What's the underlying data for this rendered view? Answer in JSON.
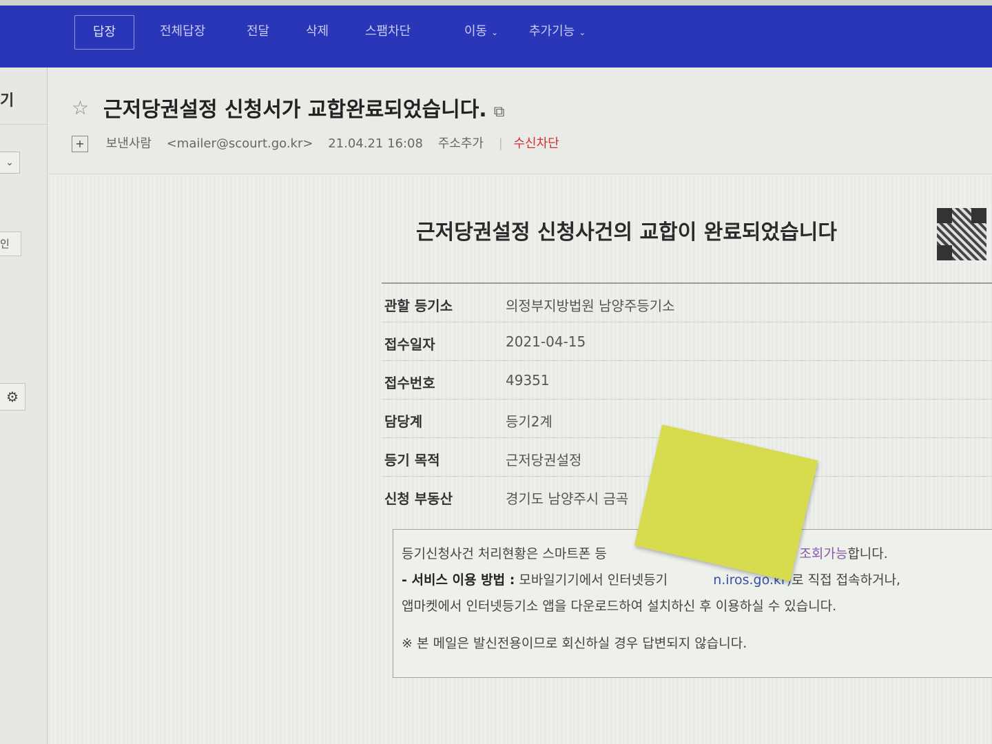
{
  "toolbar": {
    "reply": "답장",
    "reply_all": "전체답장",
    "forward": "전달",
    "delete": "삭제",
    "spam_block": "스팸차단",
    "move": "이동",
    "more": "추가기능",
    "bg_color": "#2a36b8"
  },
  "sidebar": {
    "title_fragment": "기",
    "tag_fragment": "인"
  },
  "mail": {
    "subject": "근저당권설정 신청서가 교합완료되었습니다.",
    "sender_name": "보낸사람",
    "sender_email": "<mailer@scourt.go.kr>",
    "date": "21.04.21 16:08",
    "add_contact": "주소추가",
    "block_sender": "수신차단",
    "block_color": "#d33030"
  },
  "document": {
    "title": "근저당권설정 신청사건의 교합이 완료되었습니다",
    "rows": [
      {
        "label": "관할 등기소",
        "value": "의정부지방법원 남양주등기소"
      },
      {
        "label": "접수일자",
        "value": "2021-04-15"
      },
      {
        "label": "접수번호",
        "value": "49351"
      },
      {
        "label": "담당계",
        "value": "등기2계"
      },
      {
        "label": "등기 목적",
        "value": "근저당권설정"
      },
      {
        "label": "신청 부동산",
        "value": "경기도 남양주시 금곡"
      }
    ],
    "notice": {
      "line1_a": "등기신청사건 처리현황은 스마트폰 등",
      "line1_b": "여 조회가능",
      "line1_c": "합니다.",
      "line2_bold": "- 서비스 이용 방법 :",
      "line2_a": " 모바일기기에서 인터넷등기",
      "line2_link": "n.iros.go.kr)",
      "line2_b": "로 직접 접속하거나,",
      "line3": "앱마켓에서 인터넷등기소 앱을 다운로드하여 설치하신 후 이용하실 수 있습니다.",
      "line4": "※ 본 메일은 발신전용이므로 회신하실 경우 답변되지 않습니다."
    }
  }
}
